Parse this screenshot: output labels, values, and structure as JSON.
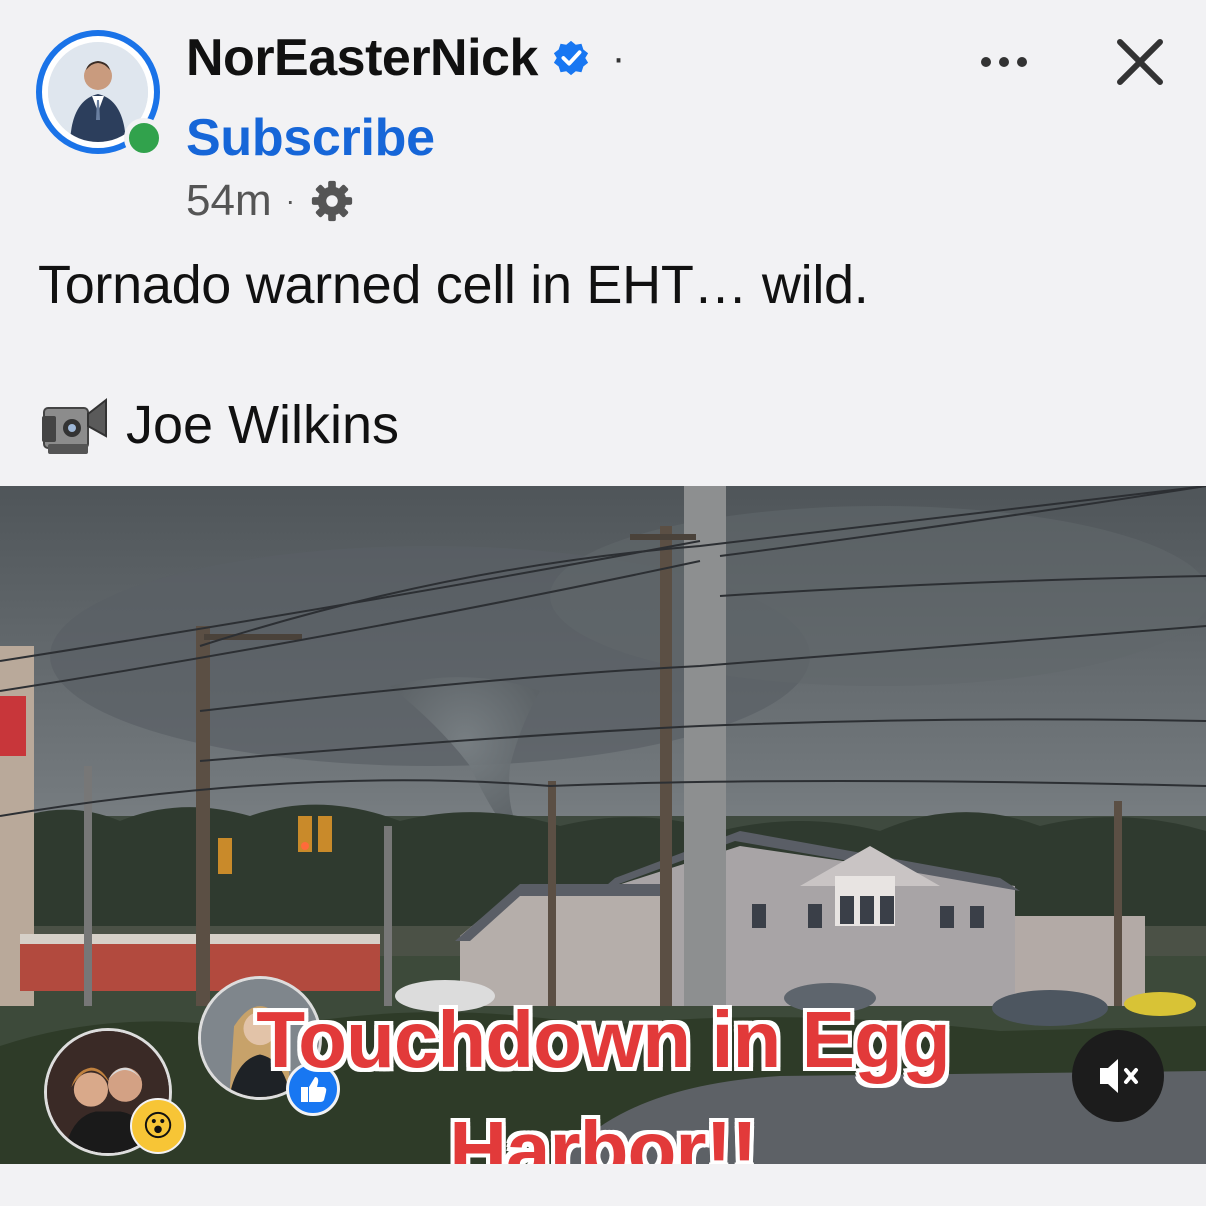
{
  "header": {
    "author_name": "NorEasterNick",
    "separator": "·",
    "subscribe_label": "Subscribe",
    "timestamp": "54m",
    "meta_separator": "·",
    "privacy_icon": "gear-icon",
    "more_icon": "more-horizontal-icon",
    "close_icon": "close-icon",
    "verified_icon": "verified-badge-icon",
    "online_status_color": "#31a24c",
    "accent_color": "#1666d8"
  },
  "post": {
    "text": "Tornado warned cell in EHT… wild.",
    "credit_icon": "video-camera-icon",
    "credit_name": "Joe Wilkins"
  },
  "media": {
    "caption_line1": "Touchdown in Egg",
    "caption_line2": "Harbor!!",
    "caption_color": "#e23a3a",
    "mute_icon": "speaker-muted-icon",
    "reaction_emoji": "😮",
    "like_icon": "thumbs-up-icon"
  }
}
